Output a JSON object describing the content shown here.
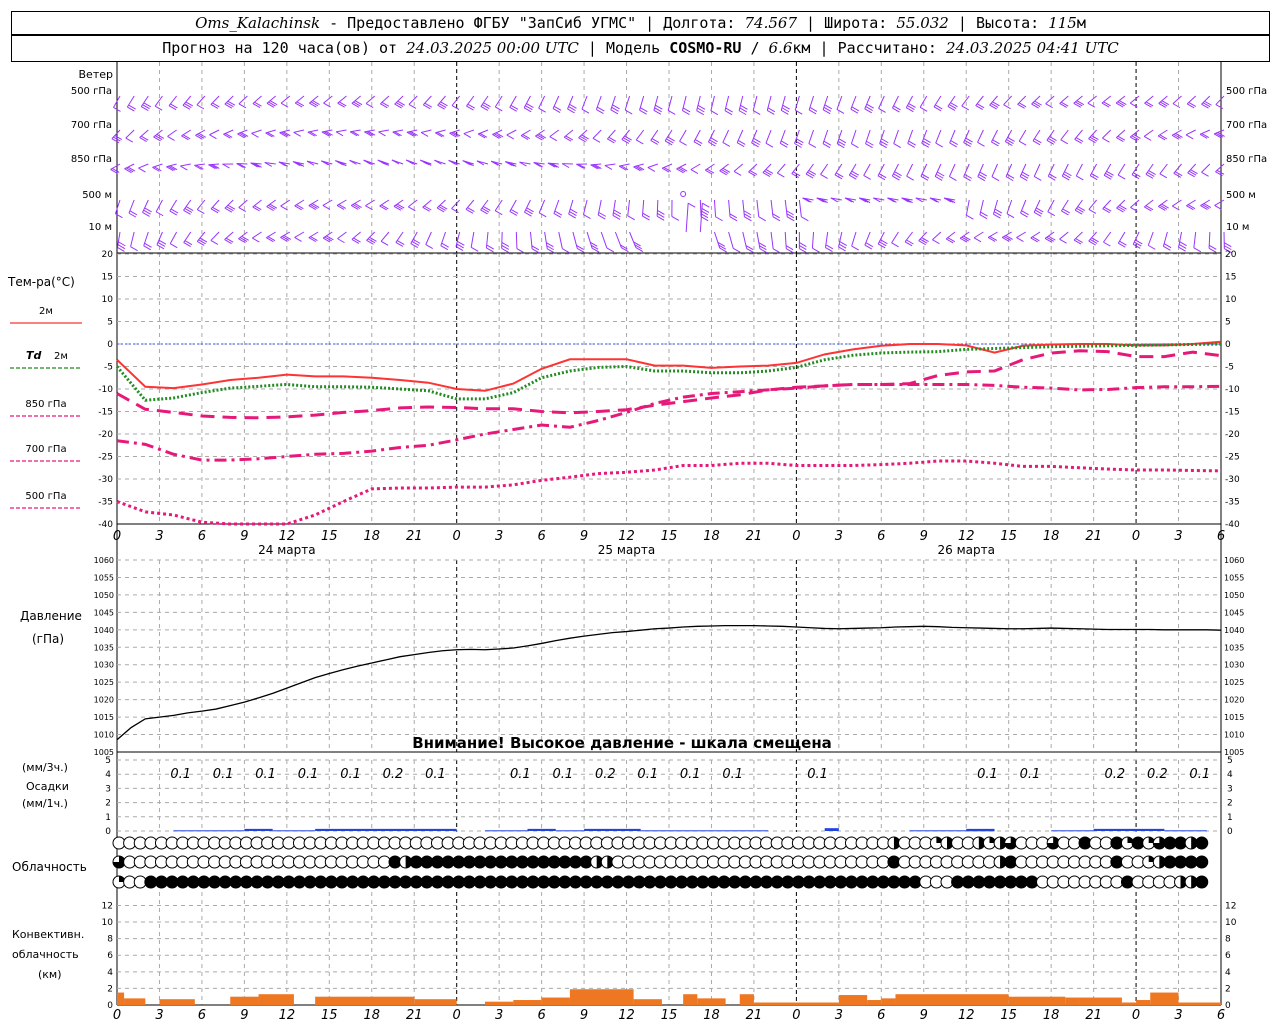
{
  "header": {
    "station": "Oms_Kalachinsk",
    "provider": "Предоставлено ФГБУ \"ЗапСиб УГМС\"",
    "lon_label": "Долгота:",
    "lon": "74.567",
    "lat_label": "Широта:",
    "lat": "55.032",
    "alt_label": "Высота:",
    "alt": "115",
    "alt_unit": "м",
    "forecast_label": "Прогноз на 120 часа(ов) от",
    "forecast_from": "24.03.2025 00:00 UTC",
    "model_label": "Модель",
    "model": "COSMO-RU",
    "resolution": "6.6",
    "res_unit": "км",
    "computed_label": "Рассчитано:",
    "computed": "24.03.2025 04:41 UTC"
  },
  "wind": {
    "title": "Ветер",
    "levels": [
      "500 гПа",
      "700 гПа",
      "850 гПа",
      "500 м",
      "10 м"
    ],
    "color": "#9933ff"
  },
  "temperature": {
    "title": "Тем-ра(°C)",
    "legend": [
      {
        "label": "2м",
        "color": "#ff3333",
        "style": "solid"
      },
      {
        "label": "Td 2м",
        "color": "#228b22",
        "style": "dotted"
      },
      {
        "label": "850 гПа",
        "color": "#e6197a",
        "style": "dash"
      },
      {
        "label": "700 гПа",
        "color": "#e6197a",
        "style": "dashdot"
      },
      {
        "label": "500 гПа",
        "color": "#e6197a",
        "style": "fine-dot"
      }
    ],
    "ticks": [
      "20",
      "15",
      "10",
      "5",
      "0",
      "-5",
      "-10",
      "-15",
      "-20",
      "-25",
      "-30",
      "-35",
      "-40"
    ]
  },
  "time_axis": {
    "hour_labels": [
      "0",
      "3",
      "6",
      "9",
      "12",
      "15",
      "18",
      "21",
      "0",
      "3",
      "6",
      "9",
      "12",
      "15",
      "18",
      "21",
      "0",
      "3",
      "6",
      "9",
      "12",
      "15",
      "18",
      "21",
      "0",
      "3",
      "6"
    ],
    "days": [
      "24 марта",
      "25 марта",
      "26 марта"
    ]
  },
  "pressure": {
    "title": "Давление",
    "unit": "(гПа)",
    "ticks": [
      "1060",
      "1055",
      "1050",
      "1045",
      "1040",
      "1035",
      "1030",
      "1025",
      "1020",
      "1015",
      "1010",
      "1005"
    ],
    "warning": "Внимание! Высокое давление - шкала смещена"
  },
  "precip": {
    "label1": "(мм/3ч.)",
    "label2": "Осадки",
    "label3": "(мм/1ч.)",
    "ticks": [
      "5",
      "4",
      "3",
      "2",
      "1",
      "0"
    ],
    "labels3h": [
      {
        "h": 6,
        "v": "0.1"
      },
      {
        "h": 9,
        "v": "0.1"
      },
      {
        "h": 12,
        "v": "0.1"
      },
      {
        "h": 15,
        "v": "0.1"
      },
      {
        "h": 18,
        "v": "0.1"
      },
      {
        "h": 21,
        "v": "0.2"
      },
      {
        "h": 24,
        "v": "0.1"
      },
      {
        "h": 30,
        "v": "0.1"
      },
      {
        "h": 33,
        "v": "0.1"
      },
      {
        "h": 36,
        "v": "0.2"
      },
      {
        "h": 39,
        "v": "0.1"
      },
      {
        "h": 42,
        "v": "0.1"
      },
      {
        "h": 45,
        "v": "0.1"
      },
      {
        "h": 51,
        "v": "0.1"
      },
      {
        "h": 63,
        "v": "0.1"
      },
      {
        "h": 66,
        "v": "0.1"
      },
      {
        "h": 72,
        "v": "0.2"
      },
      {
        "h": 75,
        "v": "0.2"
      },
      {
        "h": 78,
        "v": "0.1"
      }
    ]
  },
  "clouds": {
    "title": "Облачность"
  },
  "convective": {
    "title1": "Конвективн.",
    "title2": "облачность",
    "title3": "(км)",
    "ticks": [
      "12",
      "10",
      "8",
      "6",
      "4",
      "2",
      "0"
    ]
  },
  "chart_data": [
    {
      "type": "line",
      "title": "Тем-ра(°C)",
      "x_unit": "hours from 24.03.2025 00:00 UTC",
      "ylim": [
        -40,
        20
      ],
      "grid": true,
      "series": [
        {
          "name": "2м",
          "x": [
            0,
            2,
            4,
            6,
            8,
            10,
            12,
            14,
            16,
            18,
            20,
            22,
            24,
            26,
            28,
            30,
            32,
            34,
            36,
            38,
            40,
            42,
            44,
            46,
            48,
            50,
            52,
            54,
            56,
            58,
            60,
            62,
            64,
            66,
            68,
            70,
            72,
            74,
            76,
            78
          ],
          "values": [
            -3.5,
            -9.5,
            -9.8,
            -9,
            -8,
            -7.5,
            -6.8,
            -7.2,
            -7.2,
            -7.5,
            -8,
            -8.6,
            -10,
            -10.4,
            -8.8,
            -5.5,
            -3.4,
            -3.4,
            -3.4,
            -4.8,
            -4.8,
            -5.3,
            -5,
            -4.8,
            -4.2,
            -2.3,
            -1.2,
            -0.4,
            0,
            0,
            -0.3,
            -1.9,
            -0.4,
            -0.1,
            0,
            0,
            -0.3,
            -0.3,
            0,
            0.5
          ]
        },
        {
          "name": "Td 2м",
          "x": [
            0,
            2,
            4,
            6,
            8,
            10,
            12,
            14,
            16,
            18,
            20,
            22,
            24,
            26,
            28,
            30,
            32,
            34,
            36,
            38,
            40,
            42,
            44,
            46,
            48,
            50,
            52,
            54,
            56,
            58,
            60,
            62,
            64,
            66,
            68,
            70,
            72,
            74,
            76,
            78
          ],
          "values": [
            -5,
            -12.5,
            -12,
            -10.8,
            -9.8,
            -9.4,
            -9,
            -9.5,
            -9.5,
            -9.6,
            -10,
            -10.4,
            -12.2,
            -12.2,
            -10.8,
            -7.5,
            -6,
            -5.2,
            -5,
            -6,
            -6,
            -6.4,
            -6.4,
            -6,
            -5.2,
            -3.5,
            -2.5,
            -2,
            -1.8,
            -1.7,
            -1.2,
            -1,
            -0.8,
            -0.6,
            -0.5,
            -0.4,
            -0.3,
            -0.2,
            -0.1,
            0
          ]
        },
        {
          "name": "850 гПа",
          "x": [
            0,
            2,
            4,
            6,
            8,
            10,
            12,
            14,
            16,
            18,
            20,
            22,
            24,
            26,
            28,
            30,
            32,
            34,
            36,
            38,
            40,
            42,
            44,
            46,
            48,
            50,
            52,
            54,
            56,
            58,
            60,
            62,
            64,
            66,
            68,
            70,
            72,
            74,
            76,
            78
          ],
          "values": [
            -11,
            -14.5,
            -15.2,
            -16,
            -16.3,
            -16.4,
            -16.2,
            -15.8,
            -15.2,
            -14.8,
            -14.2,
            -14,
            -14.1,
            -14.4,
            -14.4,
            -15,
            -15.3,
            -15,
            -14.6,
            -13.6,
            -12.8,
            -12,
            -11.3,
            -10.2,
            -9.6,
            -9.3,
            -9,
            -9,
            -8.8,
            -7,
            -6.2,
            -6,
            -3.5,
            -2,
            -1.5,
            -1.7,
            -2.8,
            -2.8,
            -1.8,
            -2.6
          ]
        },
        {
          "name": "700 гПа",
          "x": [
            0,
            2,
            4,
            6,
            8,
            10,
            12,
            14,
            16,
            18,
            20,
            22,
            24,
            26,
            28,
            30,
            32,
            34,
            36,
            38,
            40,
            42,
            44,
            46,
            48,
            50,
            52,
            54,
            56,
            58,
            60,
            62,
            64,
            66,
            68,
            70,
            72,
            74,
            76,
            78
          ],
          "values": [
            -21.5,
            -22.3,
            -24.5,
            -25.8,
            -25.8,
            -25.5,
            -25,
            -24.5,
            -24.3,
            -23.8,
            -23,
            -22.5,
            -21.3,
            -20,
            -19,
            -18,
            -18.5,
            -17,
            -15.2,
            -13.2,
            -11.8,
            -11,
            -10.6,
            -10.2,
            -9.8,
            -9.3,
            -9,
            -9,
            -9,
            -9,
            -9,
            -9.2,
            -9.6,
            -9.8,
            -10.2,
            -10.1,
            -9.7,
            -9.5,
            -9.5,
            -9.4
          ]
        },
        {
          "name": "500 гПа",
          "x": [
            0,
            2,
            4,
            6,
            8,
            10,
            12,
            14,
            16,
            18,
            20,
            22,
            24,
            26,
            28,
            30,
            32,
            34,
            36,
            38,
            40,
            42,
            44,
            46,
            48,
            50,
            52,
            54,
            56,
            58,
            60,
            62,
            64,
            66,
            68,
            70,
            72,
            74,
            76,
            78
          ],
          "values": [
            -35,
            -37.3,
            -38,
            -39.6,
            -40,
            -40,
            -40,
            -38,
            -35,
            -32.2,
            -32,
            -32,
            -31.8,
            -31.8,
            -31.3,
            -30.3,
            -29.6,
            -28.8,
            -28.5,
            -28,
            -27,
            -27,
            -26.5,
            -26.5,
            -27,
            -27,
            -27,
            -26.8,
            -26.5,
            -26,
            -26,
            -26.5,
            -27.2,
            -27.2,
            -27.5,
            -27.8,
            -28,
            -28,
            -28.1,
            -28.2
          ]
        }
      ]
    },
    {
      "type": "line",
      "title": "Давление",
      "ylabel": "(гПа)",
      "ylim": [
        1005,
        1060
      ],
      "series": [
        {
          "x": [
            0,
            1,
            2,
            3,
            4,
            5,
            6,
            7,
            8,
            9,
            10,
            11,
            12,
            13,
            14,
            15,
            16,
            17,
            18,
            19,
            20,
            21,
            22,
            23,
            24,
            25,
            26,
            27,
            28,
            29,
            30,
            31,
            32,
            33,
            34,
            35,
            36,
            37,
            38,
            39,
            40,
            41,
            42,
            43,
            44,
            45,
            46,
            47,
            48,
            49,
            50,
            51,
            52,
            53,
            54,
            55,
            56,
            57,
            58,
            59,
            60,
            61,
            62,
            63,
            64,
            65,
            66,
            67,
            68,
            69,
            70,
            71,
            72,
            73,
            74,
            75,
            76,
            77,
            78
          ],
          "values": [
            1008.5,
            1012,
            1014.5,
            1015,
            1015.5,
            1016.2,
            1016.7,
            1017.3,
            1018.3,
            1019.3,
            1020.5,
            1021.8,
            1023.3,
            1024.8,
            1026.3,
            1027.5,
            1028.6,
            1029.6,
            1030.5,
            1031.4,
            1032.3,
            1032.9,
            1033.5,
            1034,
            1034.3,
            1034.4,
            1034.3,
            1034.5,
            1034.8,
            1035.4,
            1036.1,
            1036.9,
            1037.6,
            1038.2,
            1038.7,
            1039.2,
            1039.5,
            1039.9,
            1040.3,
            1040.5,
            1040.8,
            1041,
            1041.1,
            1041.2,
            1041.2,
            1041.2,
            1041.1,
            1041,
            1040.8,
            1040.6,
            1040.4,
            1040.3,
            1040.4,
            1040.5,
            1040.6,
            1040.8,
            1040.9,
            1041,
            1040.9,
            1040.7,
            1040.6,
            1040.5,
            1040.4,
            1040.3,
            1040.3,
            1040.4,
            1040.5,
            1040.4,
            1040.3,
            1040.2,
            1040.1,
            1040.1,
            1040.1,
            1040.1,
            1040,
            1040,
            1040,
            1040,
            1039.9
          ]
        }
      ]
    },
    {
      "type": "bar",
      "title": "Конвективн. облачность",
      "ylabel": "(км)",
      "ylim": [
        0,
        13
      ],
      "x_unit": "hours",
      "segments": [
        {
          "h0": 0,
          "h1": 0.5,
          "v": 1.5
        },
        {
          "h0": 0.5,
          "h1": 2,
          "v": 0.8
        },
        {
          "h0": 3,
          "h1": 5.5,
          "v": 0.7
        },
        {
          "h0": 8,
          "h1": 10,
          "v": 1.0
        },
        {
          "h0": 10,
          "h1": 12.5,
          "v": 1.3
        },
        {
          "h0": 14,
          "h1": 21,
          "v": 1.0
        },
        {
          "h0": 21,
          "h1": 24,
          "v": 0.7
        },
        {
          "h0": 26,
          "h1": 28,
          "v": 0.4
        },
        {
          "h0": 28,
          "h1": 30,
          "v": 0.6
        },
        {
          "h0": 30,
          "h1": 32,
          "v": 0.9
        },
        {
          "h0": 32,
          "h1": 36.5,
          "v": 1.9
        },
        {
          "h0": 36.5,
          "h1": 38.5,
          "v": 0.7
        },
        {
          "h0": 40,
          "h1": 41,
          "v": 1.3
        },
        {
          "h0": 41,
          "h1": 43,
          "v": 0.8
        },
        {
          "h0": 44,
          "h1": 45,
          "v": 1.3
        },
        {
          "h0": 45,
          "h1": 51,
          "v": 0.3
        },
        {
          "h0": 51,
          "h1": 53,
          "v": 1.2
        },
        {
          "h0": 53,
          "h1": 54,
          "v": 0.6
        },
        {
          "h0": 54,
          "h1": 55,
          "v": 0.8
        },
        {
          "h0": 55,
          "h1": 63,
          "v": 1.3
        },
        {
          "h0": 63,
          "h1": 67,
          "v": 1.0
        },
        {
          "h0": 67,
          "h1": 68,
          "v": 0.9
        },
        {
          "h0": 68,
          "h1": 71,
          "v": 0.9
        },
        {
          "h0": 71,
          "h1": 72,
          "v": 0.3
        },
        {
          "h0": 72,
          "h1": 73,
          "v": 0.6
        },
        {
          "h0": 73,
          "h1": 75,
          "v": 1.5
        },
        {
          "h0": 75,
          "h1": 78,
          "v": 0.3
        }
      ]
    },
    {
      "type": "bar",
      "title": "Осадки (мм/1ч.)",
      "ylim": [
        0,
        5
      ],
      "segments": [
        {
          "h0": 4,
          "h1": 9,
          "v": 0.05
        },
        {
          "h0": 9,
          "h1": 11,
          "v": 0.15
        },
        {
          "h0": 11,
          "h1": 14,
          "v": 0.05
        },
        {
          "h0": 14,
          "h1": 24,
          "v": 0.15
        },
        {
          "h0": 26,
          "h1": 29,
          "v": 0.05
        },
        {
          "h0": 29,
          "h1": 31,
          "v": 0.15
        },
        {
          "h0": 31,
          "h1": 33,
          "v": 0.05
        },
        {
          "h0": 33,
          "h1": 37,
          "v": 0.15
        },
        {
          "h0": 37,
          "h1": 46,
          "v": 0.05
        },
        {
          "h0": 50,
          "h1": 51,
          "v": 0.2
        },
        {
          "h0": 56,
          "h1": 62,
          "v": 0.05
        },
        {
          "h0": 60,
          "h1": 62,
          "v": 0.15
        },
        {
          "h0": 66,
          "h1": 69,
          "v": 0.05
        },
        {
          "h0": 69,
          "h1": 74,
          "v": 0.15
        },
        {
          "h0": 74,
          "h1": 77,
          "v": 0.05
        }
      ]
    },
    {
      "type": "table",
      "title": "Облачность",
      "cover_scale": "0=clear, 1=quarter, 2=half, 3=three-quarter, 4=overcast",
      "rows": [
        "0000000000000000000000000000000000000000000000000000000000000000000000000200012002123000300400414134424",
        "3000000000000000000000000042444444444444444442200000000000000000000000000400000000024000000000400124444",
        "1004444444444444444444444444444444444444444444444444444444444444444444444444000444444440000000040000224"
      ]
    }
  ]
}
